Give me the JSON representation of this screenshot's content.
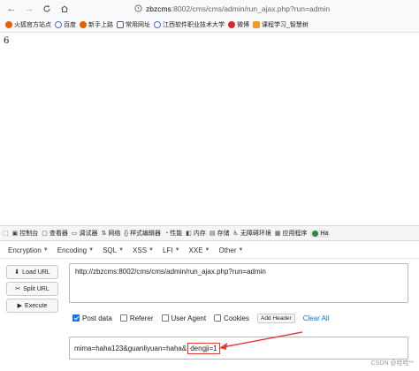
{
  "browser": {
    "url_host": "zbzcms",
    "url_path": ":8002/cms/cms/admin/run_ajax.php?run=admin"
  },
  "bookmarks": [
    {
      "label": "火狐官方站点",
      "color": "#e66000",
      "icon": "firefox-icon"
    },
    {
      "label": "百度",
      "color": "#4b6cd6",
      "icon": "globe-icon"
    },
    {
      "label": "新手上路",
      "color": "#e66000",
      "icon": "firefox-icon"
    },
    {
      "label": "常用网址",
      "color": "#5b5b66",
      "icon": "folder-icon"
    },
    {
      "label": "江西软件职业技术大学",
      "color": "#4b6cd6",
      "icon": "globe-icon"
    },
    {
      "label": "微博",
      "color": "#d52c2b",
      "icon": "weibo-icon"
    },
    {
      "label": "课程学习_智慧树",
      "color": "#f39a21",
      "icon": "zhihuishu-icon"
    }
  ],
  "page": {
    "output": "6"
  },
  "devtools": {
    "tabs": [
      {
        "label": "控制台",
        "icon": "console-icon"
      },
      {
        "label": "查看器",
        "icon": "inspector-icon"
      },
      {
        "label": "调试器",
        "icon": "debugger-icon"
      },
      {
        "label": "网络",
        "icon": "network-icon"
      },
      {
        "label": "样式编辑器",
        "icon": "style-editor-icon"
      },
      {
        "label": "性能",
        "icon": "performance-icon"
      },
      {
        "label": "内存",
        "icon": "memory-icon"
      },
      {
        "label": "存储",
        "icon": "storage-icon"
      },
      {
        "label": "无障碍环境",
        "icon": "accessibility-icon"
      },
      {
        "label": "应用程序",
        "icon": "application-icon"
      },
      {
        "label": "Ha",
        "icon": "hackbar-icon"
      }
    ]
  },
  "hackbar": {
    "menus": [
      "Encryption",
      "Encoding",
      "SQL",
      "XSS",
      "LFI",
      "XXE",
      "Other"
    ],
    "load_url": "Load URL",
    "split_url": "Split URL",
    "execute": "Execute",
    "url_value": "http://zbzcms:8002/cms/cms/admin/run_ajax.php?run=admin",
    "options": {
      "post_data": "Post data",
      "referer": "Referer",
      "user_agent": "User Agent",
      "cookies": "Cookies",
      "add_header": "Add Header",
      "clear_all": "Clear All"
    },
    "post_value_prefix": "mima=haha123&guanliyuan=haha&",
    "post_value_highlight": "dengji=1"
  },
  "watermark": "CSDN @哇哇**"
}
